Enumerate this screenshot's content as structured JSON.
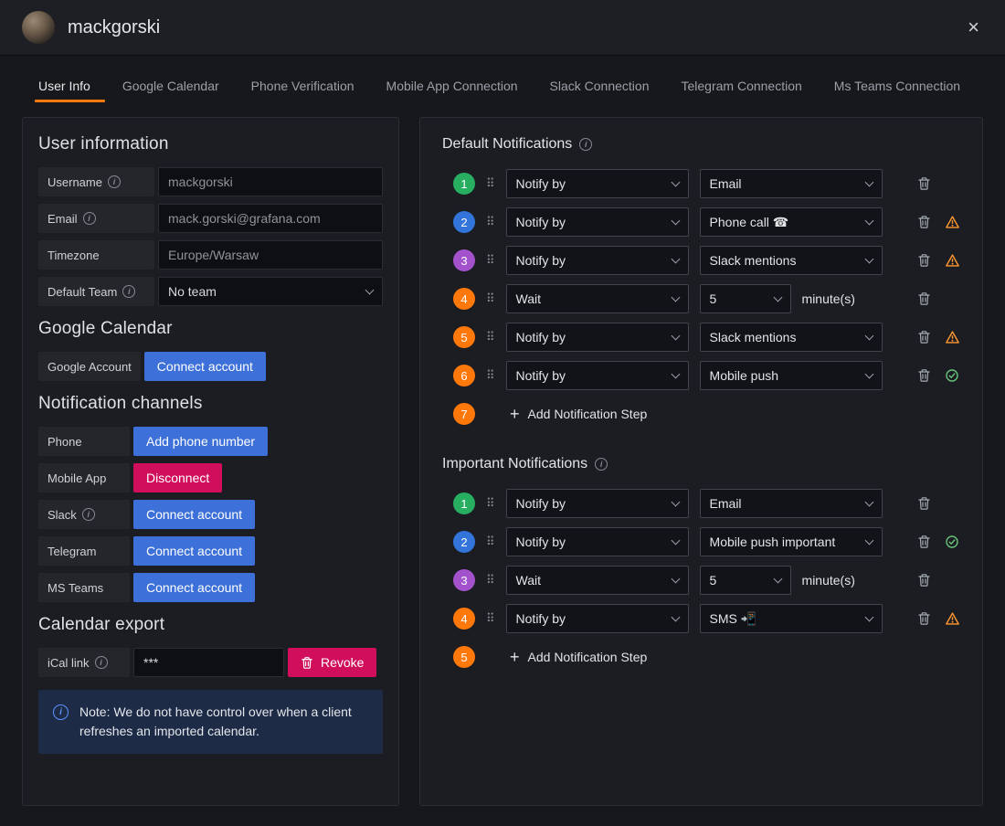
{
  "colors": {
    "accent_orange": "#ff780a",
    "primary_blue": "#3d71d9",
    "destructive_red": "#d10e5c",
    "warning_orange": "#ff9830",
    "success_green": "#67c47a",
    "step_green": "#27ae60",
    "step_blue": "#3274d9",
    "step_purple": "#a352cc",
    "step_orange": "#ff780a"
  },
  "header": {
    "title": "mackgorski",
    "close_icon": "×"
  },
  "tabs": [
    {
      "label": "User Info",
      "active": true
    },
    {
      "label": "Google Calendar",
      "active": false
    },
    {
      "label": "Phone Verification",
      "active": false
    },
    {
      "label": "Mobile App Connection",
      "active": false
    },
    {
      "label": "Slack Connection",
      "active": false
    },
    {
      "label": "Telegram Connection",
      "active": false
    },
    {
      "label": "Ms Teams Connection",
      "active": false
    }
  ],
  "left": {
    "user_info_heading": "User information",
    "fields": [
      {
        "label": "Username",
        "info": true,
        "value": "mackgorski",
        "type": "text"
      },
      {
        "label": "Email",
        "info": true,
        "value": "mack.gorski@grafana.com",
        "type": "text"
      },
      {
        "label": "Timezone",
        "info": false,
        "value": "Europe/Warsaw",
        "type": "text"
      },
      {
        "label": "Default Team",
        "info": true,
        "value": "No team",
        "type": "select"
      }
    ],
    "google_calendar_heading": "Google Calendar",
    "google_account": {
      "label": "Google Account",
      "button": "Connect account"
    },
    "channels_heading": "Notification channels",
    "channels": [
      {
        "label": "Phone",
        "info": false,
        "button": "Add phone number",
        "style": "primary"
      },
      {
        "label": "Mobile App",
        "info": false,
        "button": "Disconnect",
        "style": "destructive"
      },
      {
        "label": "Slack",
        "info": true,
        "button": "Connect account",
        "style": "primary"
      },
      {
        "label": "Telegram",
        "info": false,
        "button": "Connect account",
        "style": "primary"
      },
      {
        "label": "MS Teams",
        "info": false,
        "button": "Connect account",
        "style": "primary"
      }
    ],
    "calendar_export_heading": "Calendar export",
    "ical": {
      "label": "iCal link",
      "info": true,
      "value": "***",
      "revoke_label": "Revoke"
    },
    "note_text": "Note: We do not have control over when a client refreshes an imported calendar."
  },
  "right": {
    "default_heading": "Default Notifications",
    "important_heading": "Important Notifications",
    "add_step_label": "Add Notification Step",
    "default_steps": [
      {
        "num": "1",
        "color": "green",
        "kind": "notify",
        "primary": "Notify by",
        "secondary": "Email",
        "status": ""
      },
      {
        "num": "2",
        "color": "blue",
        "kind": "notify",
        "primary": "Notify by",
        "secondary": "Phone call ☎",
        "status": "warning"
      },
      {
        "num": "3",
        "color": "purple",
        "kind": "notify",
        "primary": "Notify by",
        "secondary": "Slack mentions",
        "status": "warning"
      },
      {
        "num": "4",
        "color": "orange",
        "kind": "wait",
        "primary": "Wait",
        "secondary": "5",
        "suffix": "minute(s)",
        "status": ""
      },
      {
        "num": "5",
        "color": "orange",
        "kind": "notify",
        "primary": "Notify by",
        "secondary": "Slack mentions",
        "status": "warning"
      },
      {
        "num": "6",
        "color": "orange",
        "kind": "notify",
        "primary": "Notify by",
        "secondary": "Mobile push",
        "status": "ok"
      },
      {
        "num": "7",
        "color": "orange",
        "kind": "add"
      }
    ],
    "important_steps": [
      {
        "num": "1",
        "color": "green",
        "kind": "notify",
        "primary": "Notify by",
        "secondary": "Email",
        "status": ""
      },
      {
        "num": "2",
        "color": "blue",
        "kind": "notify",
        "primary": "Notify by",
        "secondary": "Mobile push important",
        "status": "ok"
      },
      {
        "num": "3",
        "color": "purple",
        "kind": "wait",
        "primary": "Wait",
        "secondary": "5",
        "suffix": "minute(s)",
        "status": ""
      },
      {
        "num": "4",
        "color": "orange",
        "kind": "notify",
        "primary": "Notify by",
        "secondary": "SMS 📲",
        "status": "warning"
      },
      {
        "num": "5",
        "color": "orange",
        "kind": "add"
      }
    ]
  }
}
